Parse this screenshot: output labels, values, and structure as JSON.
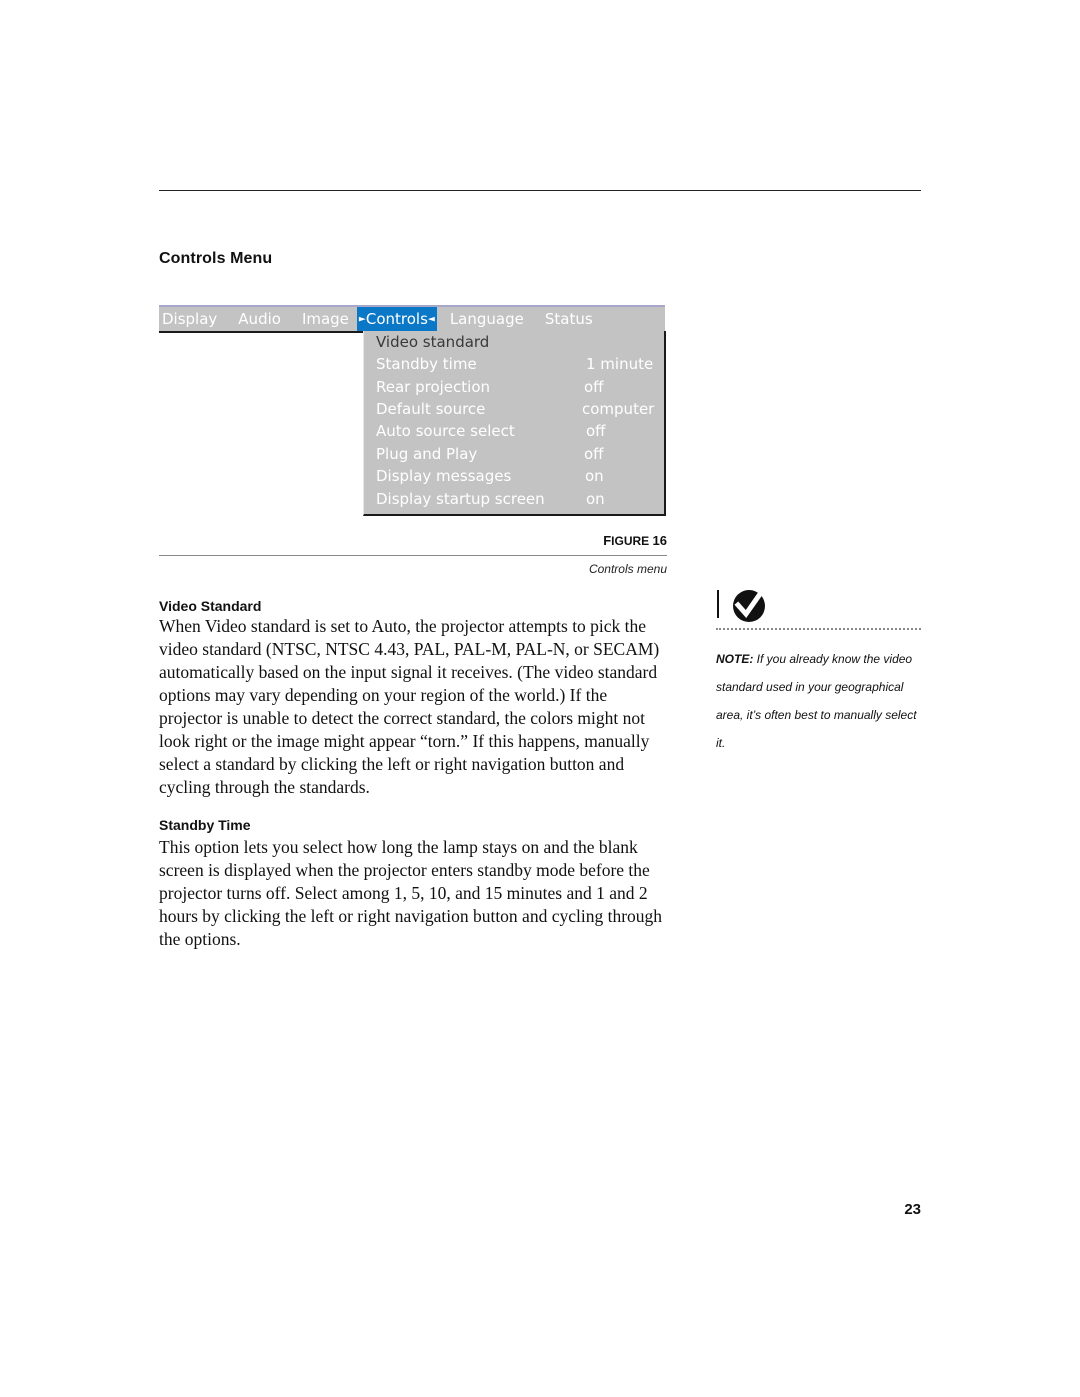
{
  "page": {
    "section_title": "Controls Menu",
    "page_number": "23"
  },
  "menu": {
    "tabs": [
      {
        "label": "Display",
        "active": false
      },
      {
        "label": "Audio",
        "active": false
      },
      {
        "label": "Image",
        "active": false
      },
      {
        "label": "Controls",
        "active": true
      },
      {
        "label": "Language",
        "active": false
      },
      {
        "label": "Status",
        "active": false
      }
    ],
    "active_marker_left": "►",
    "active_marker_right": "◄",
    "items": [
      {
        "label": "Video standard",
        "value": "",
        "selected": true
      },
      {
        "label": "Standby time",
        "value": "1 minute",
        "selected": false
      },
      {
        "label": "Rear projection",
        "value": "off",
        "selected": false
      },
      {
        "label": "Default source",
        "value": "computer",
        "selected": false
      },
      {
        "label": "Auto source select",
        "value": "off",
        "selected": false
      },
      {
        "label": "Plug and Play",
        "value": "off",
        "selected": false
      },
      {
        "label": "Display messages",
        "value": "on",
        "selected": false
      },
      {
        "label": "Display startup screen",
        "value": "on",
        "selected": false
      }
    ],
    "colors": {
      "bar_bg": "#c3c3c3",
      "active_tab_bg": "#0a78c6",
      "text": "#ffffff",
      "selected_text": "#3a3a3a"
    }
  },
  "figure": {
    "label_prefix": "F",
    "label_rest": "IGURE",
    "number": "16",
    "caption": "Controls menu"
  },
  "sections": [
    {
      "heading": "Video Standard",
      "body": "When Video standard is set to Auto, the projector attempts to pick the video standard (NTSC, NTSC 4.43, PAL, PAL-M, PAL-N, or SECAM) automatically based on the input signal it receives. (The video standard options may vary depending on your region of the world.) If the projector is unable to detect the correct standard, the colors might not look right or the image might appear “torn.” If this happens, manually select a standard by clicking the left or right navigation button and cycling through the standards."
    },
    {
      "heading": "Standby Time",
      "body": "This option lets you select how long the lamp stays on and the blank screen is displayed when the projector enters standby mode before the projector turns off. Select among 1, 5, 10, and 15 minutes and 1 and 2 hours by clicking the left or right navigation button and cycling through the options."
    }
  ],
  "note": {
    "icon": "checkmark-note-icon",
    "label": "NOTE:",
    "text": " If you already know the video standard used in your geographical area, it’s often best to manually select it."
  }
}
